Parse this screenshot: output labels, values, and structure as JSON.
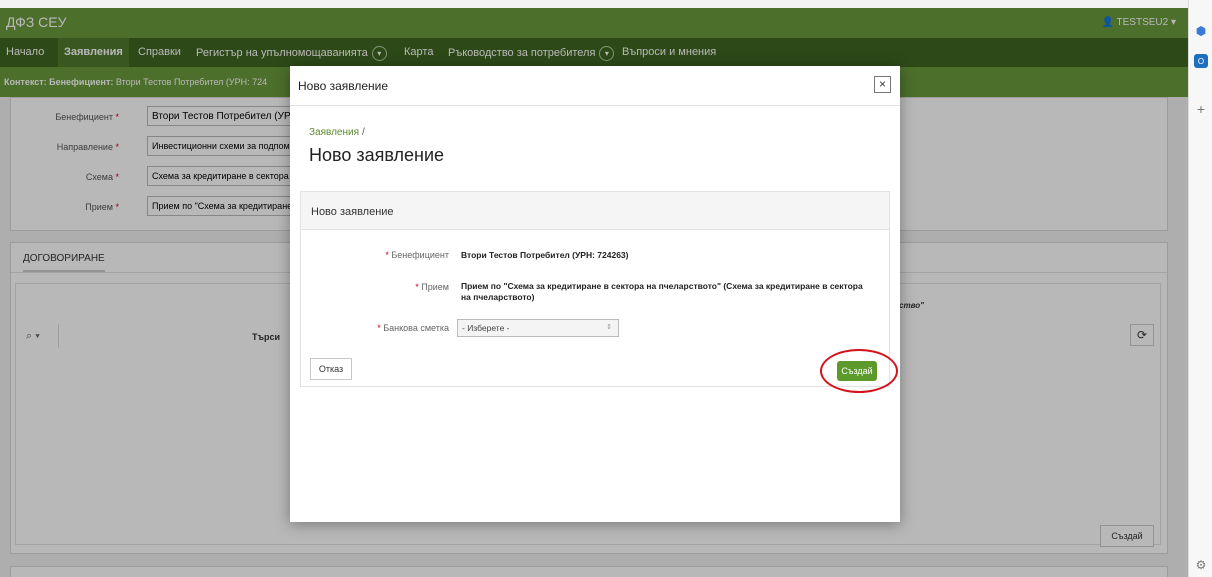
{
  "titlebar": {
    "app_title": "ДФЗ СЕУ",
    "user": "TESTSEU2 ▾"
  },
  "nav": {
    "items": [
      "Начало",
      "Заявления",
      "Справки",
      "Регистър на упълномощаванията",
      "Карта",
      "Ръководство за потребителя",
      "Въпроси и мнения"
    ]
  },
  "context": {
    "label": "Контекст: Бенефициент:",
    "value": "Втори Тестов Потребител (УРН: 724"
  },
  "background_form": {
    "beneficiary_label": "Бенефициент",
    "beneficiary_value": "Втори Тестов Потребител (УР",
    "direction_label": "Направление",
    "direction_value": "Инвестиционни схеми за подпом",
    "scheme_label": "Схема",
    "scheme_value": "Схема за кредитиране в сектора",
    "intake_label": "Прием",
    "intake_value": "Прием по \"Схема за кредитиране"
  },
  "tab_section": {
    "tab_label": "ДОГОВОРИРАНЕ",
    "search_label": "Търси",
    "partial_text": "тство\"",
    "create_button": "Създай"
  },
  "modal": {
    "title": "Ново заявление",
    "breadcrumb_link": "Заявления",
    "breadcrumb_sep": "/",
    "page_title": "Ново заявление",
    "card_title": "Ново заявление",
    "beneficiary_label": "Бенефициент",
    "beneficiary_value": "Втори Тестов Потребител (УРН: 724263)",
    "intake_label": "Прием",
    "intake_value": "Прием по \"Схема за кредитиране в сектора на пчеларството\" (Схема за кредитиране в сектора на пчеларството)",
    "bank_label": "Банкова сметка",
    "bank_placeholder": "- Изберете -",
    "cancel_label": "Отказ",
    "create_label": "Създай"
  },
  "icons": {
    "close": "close-icon",
    "search": "search-icon",
    "refresh": "refresh-icon",
    "chevron": "chevron-down-icon",
    "user": "user-icon",
    "gear": "gear-icon",
    "plus": "plus-icon"
  },
  "colors": {
    "header_green": "#6a9a3c",
    "nav_dark_green": "#3f6622",
    "accent_button": "#5d9a2c",
    "highlight_red": "#d4131b"
  }
}
